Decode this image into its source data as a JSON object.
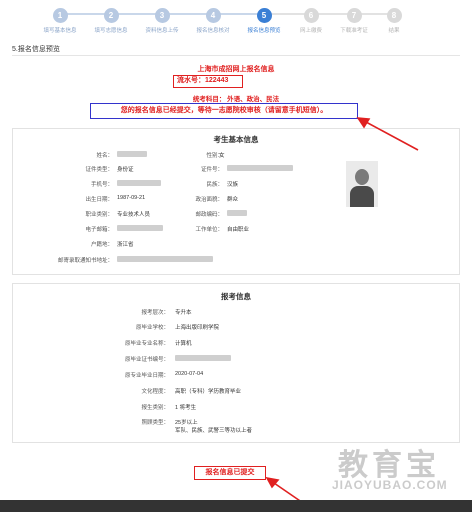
{
  "stepper": {
    "steps": [
      {
        "num": "1",
        "label": "填写基本信息"
      },
      {
        "num": "2",
        "label": "填写志愿信息"
      },
      {
        "num": "3",
        "label": "资料信息上传"
      },
      {
        "num": "4",
        "label": "报名信息核对"
      },
      {
        "num": "5",
        "label": "报名信息预览"
      },
      {
        "num": "6",
        "label": "网上缴费"
      },
      {
        "num": "7",
        "label": "下载准考证"
      },
      {
        "num": "8",
        "label": "结果"
      }
    ],
    "active_step": 5
  },
  "section_title": "5.报名信息预览",
  "summary": {
    "title": "上海市成招网上报名信息",
    "serial_label": "流水号：",
    "serial_value": "122443",
    "subjects": "统考科目：  外语、政治、民法",
    "notice": "您的报名信息已经提交，等待一志愿院校审核（请留意手机短信）。"
  },
  "basic_info": {
    "title": "考生基本信息",
    "labels": {
      "name": "姓名：",
      "gender": "性别：",
      "id_type": "证件类型：",
      "id_number": "证件号：",
      "phone": "手机号：",
      "ethnicity": "民族：",
      "birth_date": "出生日期：",
      "political": "政治面貌：",
      "occupation": "职业类别：",
      "postal_code": "邮政编码：",
      "email": "电子邮箱：",
      "employer": "工作单位：",
      "hukou": "户籍地：",
      "address": "邮寄录取通知书地址："
    },
    "values": {
      "gender": "女",
      "id_type": "身份证",
      "ethnicity": "汉族",
      "birth_date": "1987-09-21",
      "political": "群众",
      "occupation": "专业技术人员",
      "employer": "自由职业",
      "hukou": "浙江省"
    }
  },
  "exam_info": {
    "title": "报考信息",
    "labels": {
      "level": "报考层次：",
      "prev_school": "原毕业学校：",
      "prev_major": "原毕业专业名称：",
      "cert_no": "原毕业证书编号：",
      "grad_date": "原专业毕业日期：",
      "education": "文化程度：",
      "category": "报生类别：",
      "bonus": "照顾类型："
    },
    "values": {
      "level": "专升本",
      "prev_school": "上海出版印刷学院",
      "prev_major": "计算机",
      "grad_date": "2020-07-04",
      "education": "高职（专科）学历教育毕业",
      "category": "1 将考生",
      "bonus_line1": "25岁以上",
      "bonus_line2": "军队、民族、武警三等功以上者"
    }
  },
  "submitted_badge": "报名信息已提交",
  "watermark": {
    "cn": "教育宝",
    "en": "JIAOYUBAO.COM"
  },
  "colors": {
    "accent_red": "#e02020",
    "step_active": "#3a7fd5",
    "notice_border": "#3333cc"
  }
}
